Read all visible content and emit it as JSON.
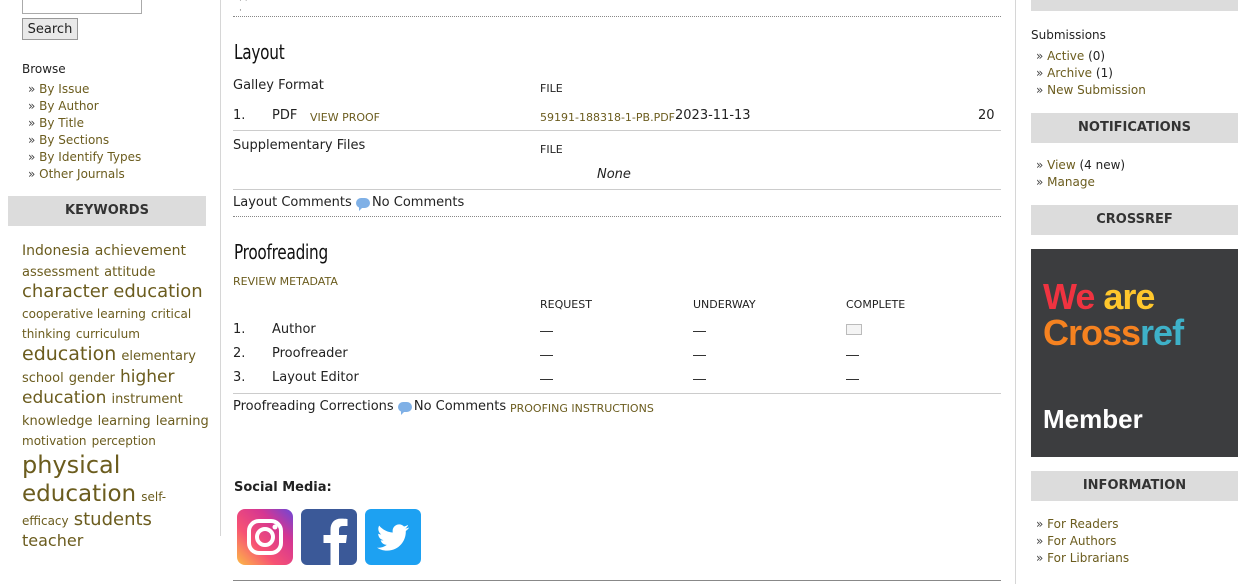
{
  "left": {
    "search_button": "Search",
    "browse_title": "Browse",
    "browse_items": [
      "By Issue",
      "By Author",
      "By Title",
      "By Sections",
      "By Identify Types",
      "Other Journals"
    ],
    "keywords_header": "KEYWORDS",
    "keywords": [
      {
        "t": "Indonesia",
        "s": 14
      },
      {
        "t": "achievement",
        "s": 14
      },
      {
        "t": "assessment",
        "s": 13
      },
      {
        "t": "attitude",
        "s": 13
      },
      {
        "t": "character",
        "s": 18
      },
      {
        "t": "education",
        "s": 18
      },
      {
        "t": "cooperative learning",
        "s": 12
      },
      {
        "t": "critical",
        "s": 12
      },
      {
        "t": "thinking",
        "s": 12
      },
      {
        "t": "curriculum",
        "s": 12
      },
      {
        "t": "education",
        "s": 19
      },
      {
        "t": "elementary",
        "s": 13
      },
      {
        "t": "school",
        "s": 13
      },
      {
        "t": "gender",
        "s": 13
      },
      {
        "t": "higher",
        "s": 17
      },
      {
        "t": "education",
        "s": 17
      },
      {
        "t": "instrument",
        "s": 13
      },
      {
        "t": "knowledge",
        "s": 13
      },
      {
        "t": "learning",
        "s": 13
      },
      {
        "t": "learning",
        "s": 13
      },
      {
        "t": "motivation",
        "s": 12
      },
      {
        "t": "perception",
        "s": 12
      },
      {
        "t": "physical",
        "s": 24
      },
      {
        "t": "education",
        "s": 23
      },
      {
        "t": "self-efficacy",
        "s": 12
      },
      {
        "t": "students",
        "s": 18
      },
      {
        "t": "teacher",
        "s": 16
      }
    ]
  },
  "layout": {
    "title": "Layout",
    "galley_format_label": "Galley Format",
    "file_col": "FILE",
    "row_num": "1.",
    "row_format": "PDF",
    "row_view_proof": "VIEW PROOF",
    "row_file": "59191-188318-1-PB.PDF",
    "row_date": "2023-11-13",
    "row_count": "20",
    "supp_label": "Supplementary Files",
    "supp_file_col": "FILE",
    "none": "None",
    "comments_label": "Layout Comments",
    "no_comments": "No Comments"
  },
  "proofreading": {
    "title": "Proofreading",
    "review_metadata": "REVIEW METADATA",
    "col_request": "REQUEST",
    "col_underway": "UNDERWAY",
    "col_complete": "COMPLETE",
    "rows": [
      {
        "num": "1.",
        "name": "Author"
      },
      {
        "num": "2.",
        "name": "Proofreader"
      },
      {
        "num": "3.",
        "name": "Layout Editor"
      }
    ],
    "corrections_label": "Proofreading Corrections",
    "no_comments": "No Comments",
    "instructions": "PROOFING INSTRUCTIONS"
  },
  "social": {
    "title": "Social Media:"
  },
  "right": {
    "submissions_title": "Submissions",
    "active_label": "Active",
    "active_count": "(0)",
    "archive_label": "Archive",
    "archive_count": "(1)",
    "new_submission": "New Submission",
    "notifications_header": "NOTIFICATIONS",
    "view_label": "View",
    "view_count": "(4 new)",
    "manage": "Manage",
    "crossref_header": "CROSSREF",
    "crossref_line1a": "We",
    "crossref_line1b": "are",
    "crossref_line2a": "Cross",
    "crossref_line2b": "ref",
    "crossref_member": "Member",
    "information_header": "INFORMATION",
    "info_items": [
      "For Readers",
      "For Authors",
      "For Librarians"
    ]
  }
}
